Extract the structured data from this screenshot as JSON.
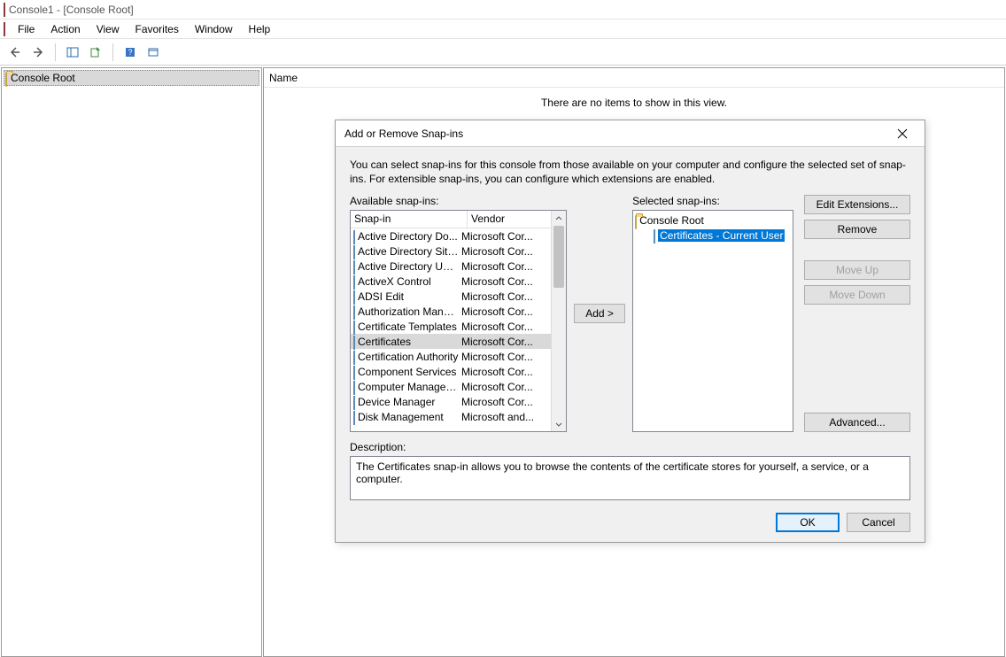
{
  "window": {
    "title": "Console1 - [Console Root]"
  },
  "menu": {
    "items": [
      "File",
      "Action",
      "View",
      "Favorites",
      "Window",
      "Help"
    ]
  },
  "tree": {
    "root": "Console Root"
  },
  "list": {
    "col_name": "Name",
    "empty": "There are no items to show in this view."
  },
  "dialog": {
    "title": "Add or Remove Snap-ins",
    "intro": "You can select snap-ins for this console from those available on your computer and configure the selected set of snap-ins. For extensible snap-ins, you can configure which extensions are enabled.",
    "available_label": "Available snap-ins:",
    "selected_label": "Selected snap-ins:",
    "col_snapin": "Snap-in",
    "col_vendor": "Vendor",
    "add_button": "Add >",
    "edit_ext": "Edit Extensions...",
    "remove": "Remove",
    "move_up": "Move Up",
    "move_down": "Move Down",
    "advanced": "Advanced...",
    "desc_label": "Description:",
    "description": "The Certificates snap-in allows you to browse the contents of the certificate stores for yourself, a service, or a computer.",
    "ok": "OK",
    "cancel": "Cancel",
    "available": [
      {
        "name": "Active Directory Do...",
        "vendor": "Microsoft Cor..."
      },
      {
        "name": "Active Directory Site...",
        "vendor": "Microsoft Cor..."
      },
      {
        "name": "Active Directory Use...",
        "vendor": "Microsoft Cor..."
      },
      {
        "name": "ActiveX Control",
        "vendor": "Microsoft Cor..."
      },
      {
        "name": "ADSI Edit",
        "vendor": "Microsoft Cor..."
      },
      {
        "name": "Authorization Manager",
        "vendor": "Microsoft Cor..."
      },
      {
        "name": "Certificate Templates",
        "vendor": "Microsoft Cor..."
      },
      {
        "name": "Certificates",
        "vendor": "Microsoft Cor...",
        "selected": true
      },
      {
        "name": "Certification Authority",
        "vendor": "Microsoft Cor..."
      },
      {
        "name": "Component Services",
        "vendor": "Microsoft Cor..."
      },
      {
        "name": "Computer Managem...",
        "vendor": "Microsoft Cor..."
      },
      {
        "name": "Device Manager",
        "vendor": "Microsoft Cor..."
      },
      {
        "name": "Disk Management",
        "vendor": "Microsoft and..."
      }
    ],
    "selected_tree": {
      "root": "Console Root",
      "child": "Certificates - Current User"
    }
  }
}
